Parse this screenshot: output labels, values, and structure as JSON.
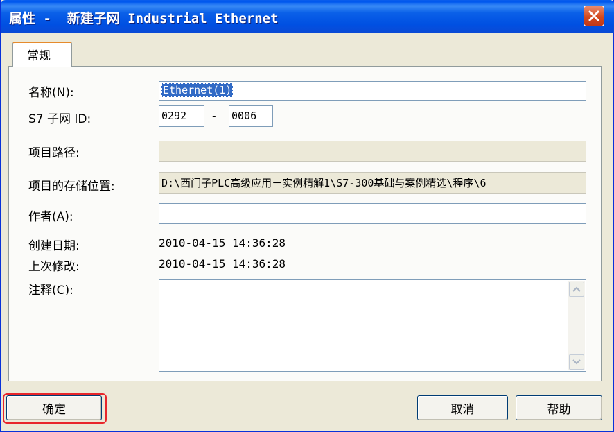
{
  "window": {
    "title": "属性 -  新建子网 Industrial Ethernet",
    "close_icon": "close-icon",
    "accent_color": "#0058ee",
    "highlight_color": "#e8262b"
  },
  "tabs": [
    {
      "label": "常规",
      "active": true
    }
  ],
  "form": {
    "name_label": "名称(N):",
    "name_value": "Ethernet(1)",
    "subnet_id_label": "S7 子网 ID:",
    "subnet_id_part1": "0292",
    "subnet_id_separator": "-",
    "subnet_id_part2": "0006",
    "project_path_label": "项目路径:",
    "project_path_value": "",
    "storage_location_label": "项目的存储位置:",
    "storage_location_value": "D:\\西门子PLC高级应用－实例精解1\\S7-300基础与案例精选\\程序\\6",
    "author_label": "作者(A):",
    "author_value": "",
    "created_label": "创建日期:",
    "created_value": "2010-04-15 14:36:28",
    "modified_label": "上次修改:",
    "modified_value": "2010-04-15 14:36:28",
    "comment_label": "注释(C):",
    "comment_value": ""
  },
  "buttons": {
    "ok": "确定",
    "cancel": "取消",
    "help": "帮助"
  }
}
